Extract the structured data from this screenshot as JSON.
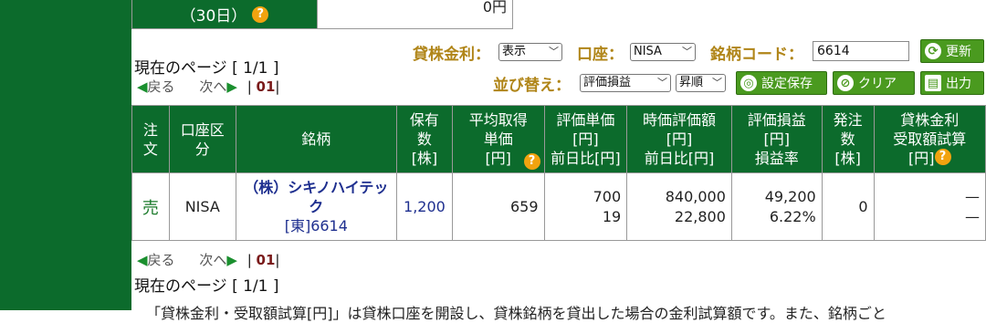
{
  "top_row": {
    "label": "（30日）",
    "value": "0円"
  },
  "paging": {
    "current_page_text": "現在のページ [ 1/1 ]",
    "back": "戻る",
    "next": "次へ",
    "sep": "|",
    "page": "01"
  },
  "controls": {
    "lending_rate_label": "貸株金利：",
    "lending_rate_value": "表示",
    "account_label": "口座：",
    "account_value": "NISA",
    "code_label": "銘柄コード：",
    "code_value": "6614",
    "update_button": "更新",
    "sort_label": "並び替え：",
    "sort_value": "評価損益",
    "order_value": "昇順",
    "save_button": "設定保存",
    "clear_button": "クリア",
    "print_button": "出力"
  },
  "table": {
    "headers": {
      "order": "注文",
      "account": "口座区分",
      "stock": "銘柄",
      "qty": "保有数[株]",
      "avg_price": "平均取得単価[円]",
      "unit_price": "評価単価[円]前日比[円]",
      "market_value": "時価評価額[円]前日比[円]",
      "pnl": "評価損益[円]損益率",
      "pending": "発注数[株]",
      "lending": "貸株金利受取額試算[円]"
    },
    "rows": [
      {
        "order": "売",
        "account": "NISA",
        "stock_name": "（株）シキノハイテック",
        "stock_code": "[東]6614",
        "qty": "1,200",
        "avg_price": "659",
        "unit_price": "700",
        "unit_change": "19",
        "market_value": "840,000",
        "market_change": "22,800",
        "pnl": "49,200",
        "pnl_rate": "6.22%",
        "pending": "0",
        "lending_1": "—",
        "lending_2": "—"
      }
    ]
  },
  "footnote": "「貸株金利・受取額試算[円]」は貸株口座を開設し、貸株銘柄を貸出した場合の金利試算額です。また、銘柄ごと"
}
